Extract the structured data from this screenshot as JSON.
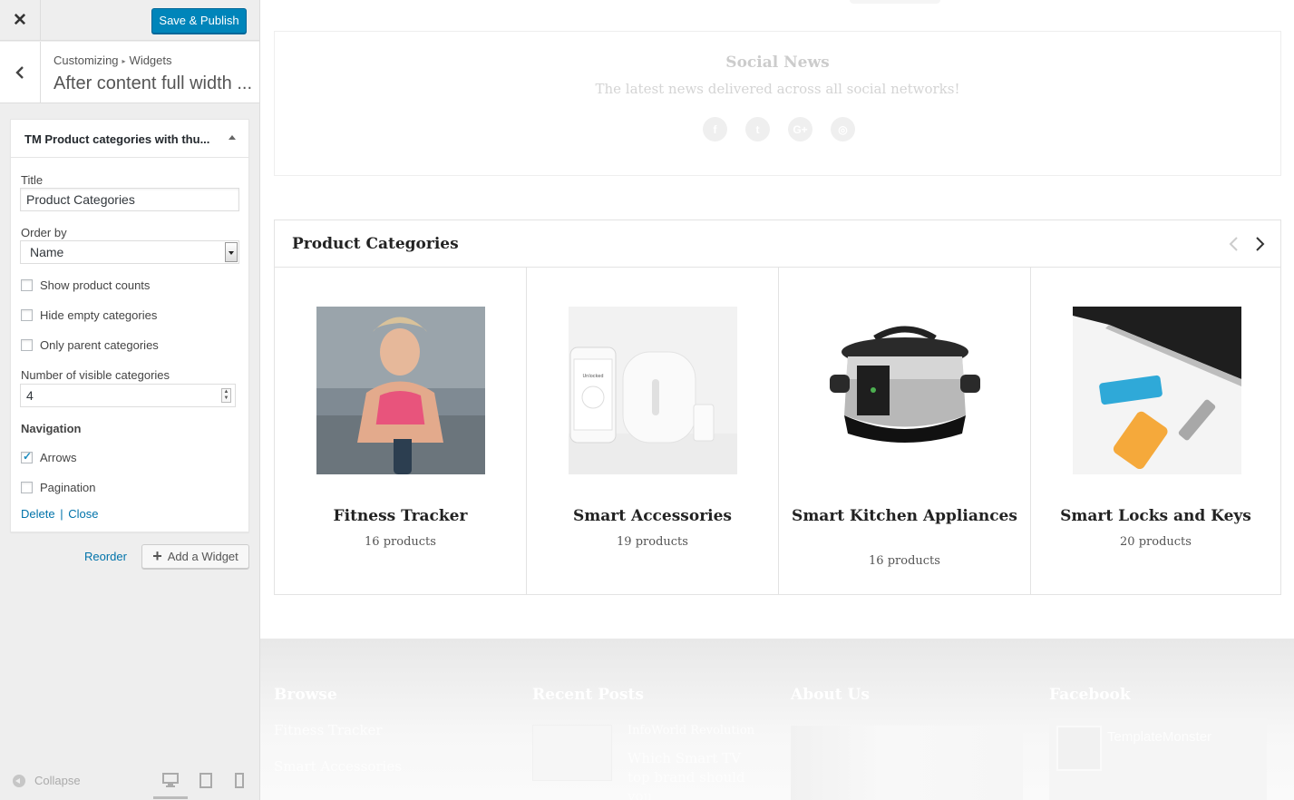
{
  "customizer": {
    "publish_label": "Save & Publish",
    "breadcrumb": {
      "root": "Customizing",
      "current": "Widgets"
    },
    "section_title": "After content full width ...",
    "widget": {
      "title": "TM Product categories with thu...",
      "fields": {
        "title_label": "Title",
        "title_value": "Product Categories",
        "order_label": "Order by",
        "order_value": "Name",
        "show_counts": "Show product counts",
        "hide_empty": "Hide empty categories",
        "only_parent": "Only parent categories",
        "visible_label": "Number of visible categories",
        "visible_value": "4",
        "navigation_heading": "Navigation",
        "arrows": "Arrows",
        "pagination": "Pagination"
      },
      "delete_label": "Delete",
      "close_label": "Close"
    },
    "reorder_label": "Reorder",
    "add_widget_label": "Add a Widget",
    "collapse_label": "Collapse"
  },
  "preview": {
    "social": {
      "title": "Social News",
      "subtitle": "The latest news delivered across all social networks!",
      "icons": [
        "facebook-icon",
        "twitter-icon",
        "google-plus-icon",
        "instagram-icon"
      ]
    },
    "product_categories": {
      "title": "Product Categories",
      "items": [
        {
          "name": "Fitness Tracker",
          "count": "16 products"
        },
        {
          "name": "Smart Accessories",
          "count": "19 products"
        },
        {
          "name": "Smart Kitchen Appliances",
          "count": "16 products"
        },
        {
          "name": "Smart Locks and Keys",
          "count": "20 products"
        }
      ]
    },
    "footer": {
      "browse": "Browse",
      "browse_links": [
        "Fitness Tracker",
        "Smart Accessories"
      ],
      "recent_posts": "Recent Posts",
      "post_meta": "InfoWorld Revolution",
      "post_title": "Which Smart TV top brand should you",
      "about": "About Us",
      "facebook": "Facebook",
      "fb_page_name": "TemplateMonster"
    }
  }
}
